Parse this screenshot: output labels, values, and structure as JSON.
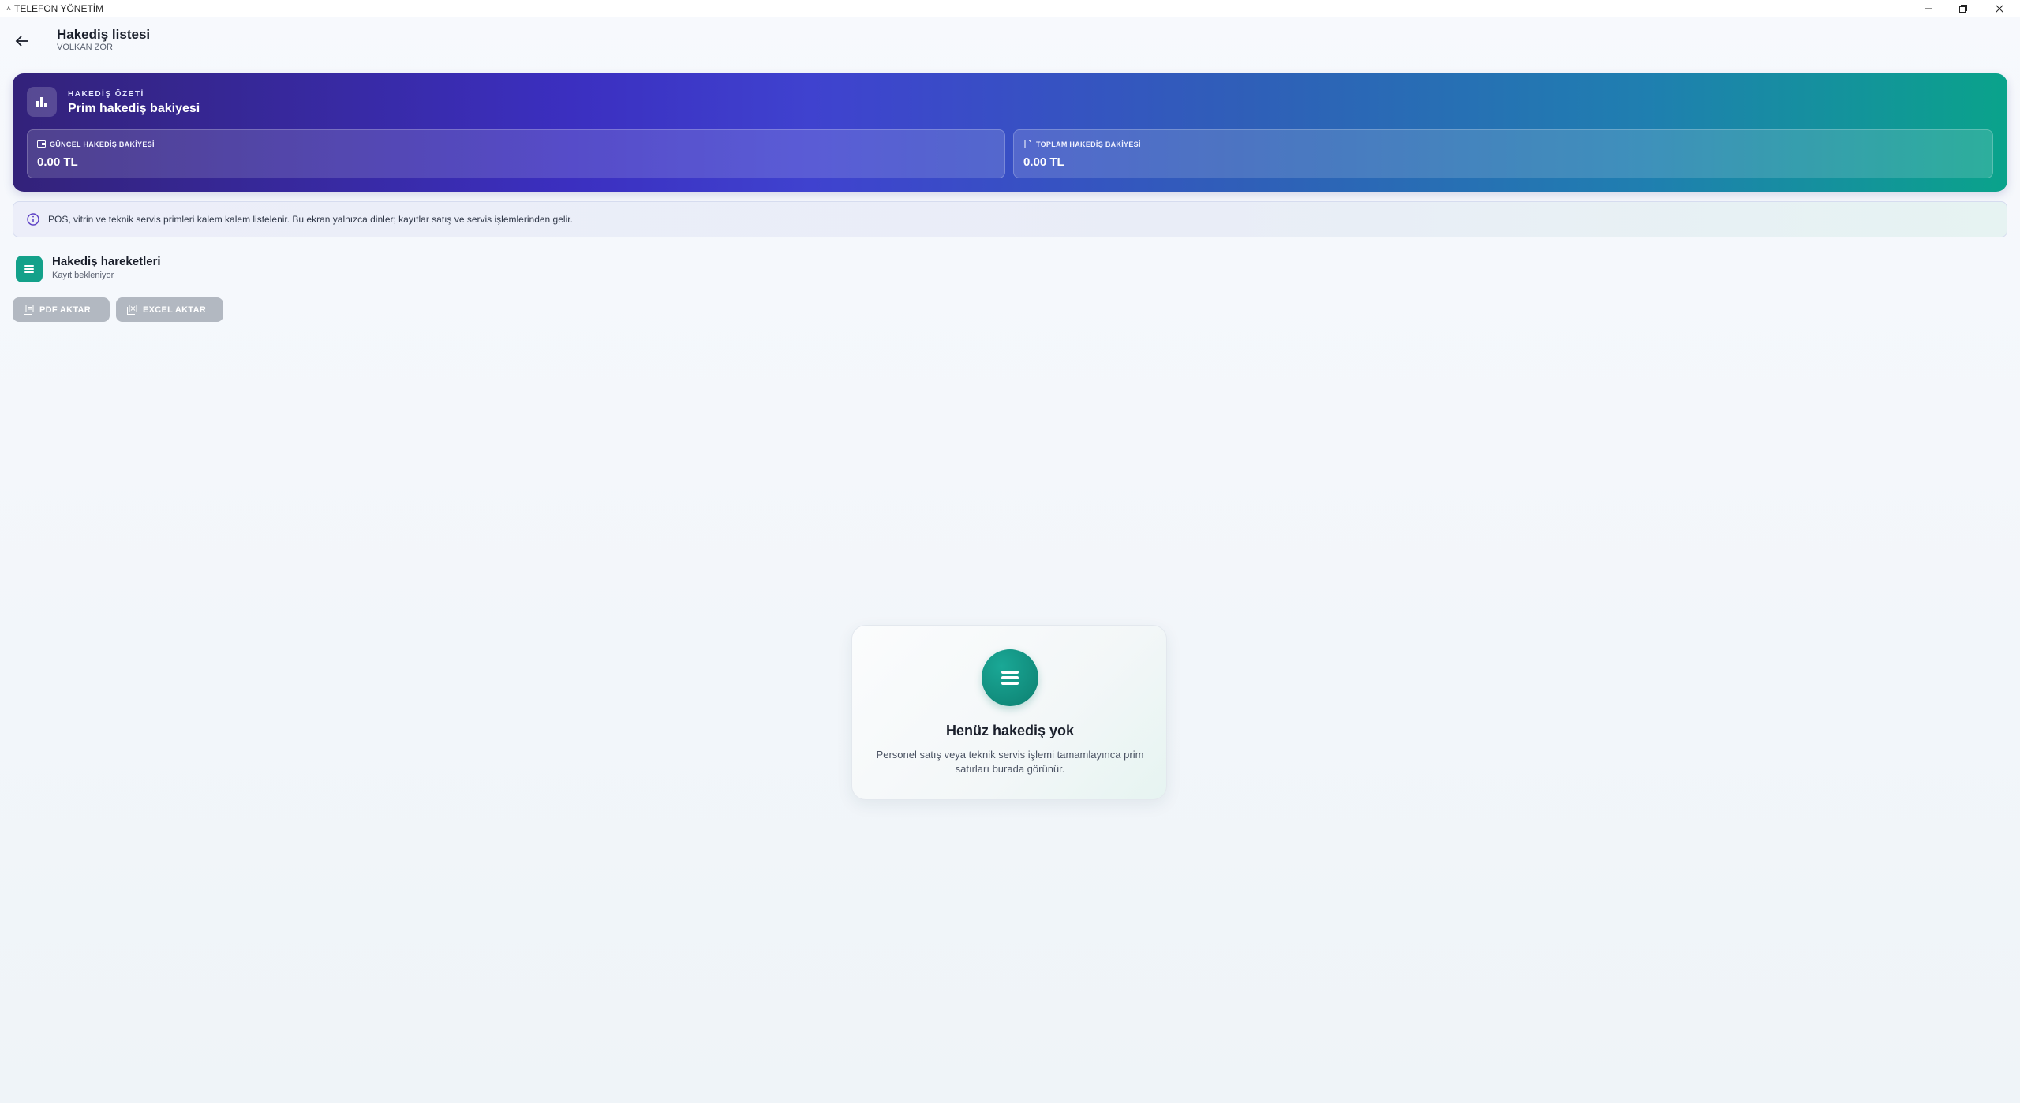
{
  "window": {
    "title": "TELEFON YÖNETİM"
  },
  "header": {
    "title": "Hakediş listesi",
    "subtitle": "VOLKAN ZOR"
  },
  "summary": {
    "eyebrow": "HAKEDİŞ ÖZETİ",
    "title": "Prim hakediş bakiyesi",
    "stats": [
      {
        "label": "GÜNCEL HAKEDİŞ BAKİYESİ",
        "value": "0.00 TL",
        "icon": "wallet-icon"
      },
      {
        "label": "TOPLAM HAKEDİŞ BAKİYESİ",
        "value": "0.00 TL",
        "icon": "document-icon"
      }
    ]
  },
  "info": {
    "text": "POS, vitrin ve teknik servis primleri kalem kalem listelenir. Bu ekran yalnızca dinler; kayıtlar satış ve servis işlemlerinden gelir."
  },
  "section": {
    "title": "Hakediş hareketleri",
    "subtitle": "Kayıt bekleniyor"
  },
  "actions": {
    "pdf_label": "PDF AKTAR",
    "excel_label": "EXCEL AKTAR"
  },
  "empty_state": {
    "title": "Henüz hakediş yok",
    "description": "Personel satış veya teknik servis işlemi tamamlayınca prim satırları burada görünür."
  },
  "colors": {
    "accent_teal": "#13a18a",
    "gradient_start": "#33227a",
    "gradient_mid": "#3b2fc0",
    "gradient_end": "#0aa38b",
    "disabled_button": "#b2b8c1"
  }
}
